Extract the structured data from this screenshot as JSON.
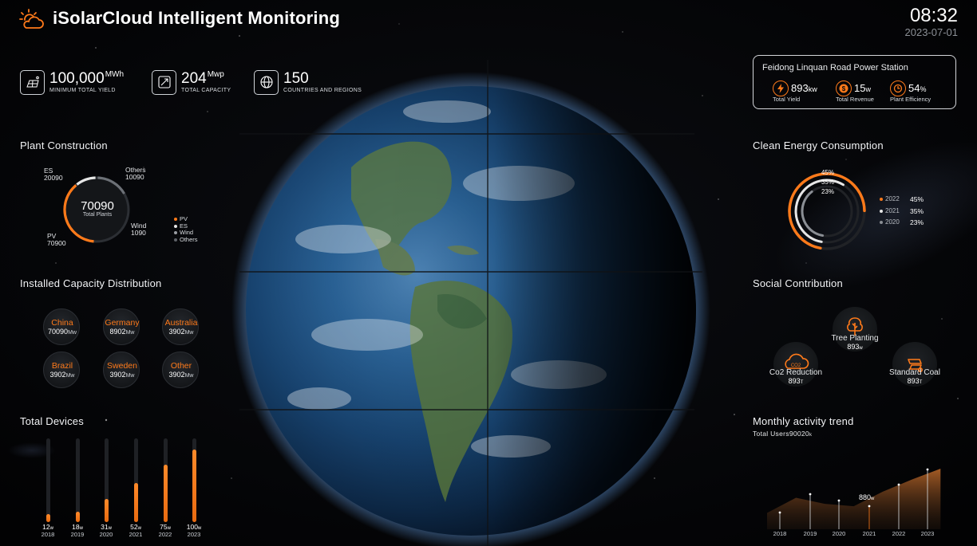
{
  "app": {
    "title": "iSolarCloud Intelligent Monitoring",
    "logo_icon": "sun-cloud-icon"
  },
  "clock": {
    "time": "08:32",
    "date": "2023-07-01"
  },
  "colors": {
    "accent": "#ff7a1a",
    "background": "#050608",
    "text": "#ffffff",
    "muted": "#8c9096"
  },
  "top_stats": [
    {
      "icon": "solar-panel-icon",
      "value": "100,000",
      "unit": "MWh",
      "label": "MINIMUM TOTAL YIELD"
    },
    {
      "icon": "capacity-icon",
      "value": "204",
      "unit": "Mwp",
      "label": "TOTAL CAPACITY"
    },
    {
      "icon": "globe-icon",
      "value": "150",
      "unit": "",
      "label": "COUNTRIES AND REGIONS"
    }
  ],
  "station": {
    "name": "Feidong Linquan Road Power Station",
    "items": [
      {
        "icon": "lightning-icon",
        "value": "893",
        "unit": "kw",
        "label": "Total Yield"
      },
      {
        "icon": "dollar-icon",
        "value": "15",
        "unit": "w",
        "label": "Total Revenue"
      },
      {
        "icon": "clock-icon",
        "value": "54",
        "unit": "%",
        "label": "Plant Efficiency"
      }
    ]
  },
  "plant_construction": {
    "title": "Plant Construction",
    "total": "70090",
    "total_label": "Total Plants",
    "segments": [
      {
        "name": "ES",
        "value": "20090"
      },
      {
        "name": "Others",
        "value": "10090"
      },
      {
        "name": "Wind",
        "value": "1090"
      },
      {
        "name": "PV",
        "value": "70900"
      }
    ],
    "legend": [
      {
        "name": "PV",
        "color": "#ff7a1a"
      },
      {
        "name": "ES",
        "color": "#e6e6e6"
      },
      {
        "name": "Wind",
        "color": "#9a9ea4"
      },
      {
        "name": "Others",
        "color": "#5e6268"
      }
    ]
  },
  "installed_capacity": {
    "title": "Installed Capacity Distribution",
    "items": [
      {
        "name": "China",
        "value": "70090",
        "unit": "Mw"
      },
      {
        "name": "Germany",
        "value": "8902",
        "unit": "Mw"
      },
      {
        "name": "Australia",
        "value": "3902",
        "unit": "Mw"
      },
      {
        "name": "Brazil",
        "value": "3902",
        "unit": "Mw"
      },
      {
        "name": "Sweden",
        "value": "3902",
        "unit": "Mw"
      },
      {
        "name": "Other",
        "value": "3902",
        "unit": "Mw"
      }
    ]
  },
  "clean_energy": {
    "title": "Clean Energy Consumption",
    "rings": [
      {
        "label": "45%",
        "year": "2022",
        "value": "45%",
        "fraction": 0.45,
        "color": "#ff7a1a"
      },
      {
        "label": "35%",
        "year": "2021",
        "value": "35%",
        "fraction": 0.35,
        "color": "#e6e6e6"
      },
      {
        "label": "23%",
        "year": "2020",
        "value": "23%",
        "fraction": 0.23,
        "color": "#8a8e94"
      }
    ]
  },
  "social": {
    "title": "Social Contribution",
    "items": [
      {
        "icon": "tree-icon",
        "label": "Tree Planting",
        "value": "893",
        "unit": "w"
      },
      {
        "icon": "co2-cloud-icon",
        "label": "Co2 Reduction",
        "value": "893",
        "unit": "T"
      },
      {
        "icon": "coal-icon",
        "label": "Standard Coal",
        "value": "893",
        "unit": "T"
      }
    ]
  },
  "devices": {
    "title": "Total Devices",
    "bars": [
      {
        "value": "12",
        "unit": "w",
        "year": "2018",
        "level": 0.1
      },
      {
        "value": "18",
        "unit": "w",
        "year": "2019",
        "level": 0.12
      },
      {
        "value": "31",
        "unit": "w",
        "year": "2020",
        "level": 0.28
      },
      {
        "value": "52",
        "unit": "w",
        "year": "2021",
        "level": 0.47
      },
      {
        "value": "75",
        "unit": "w",
        "year": "2022",
        "level": 0.69
      },
      {
        "value": "100",
        "unit": "w",
        "year": "2023",
        "level": 0.87
      }
    ]
  },
  "monthly_trend": {
    "title": "Monthly activity trend",
    "users_label": "Total Users",
    "users_value": "90020",
    "users_unit": "k",
    "callout_value": "880",
    "callout_unit": "w",
    "years": [
      "2018",
      "2019",
      "2020",
      "2021",
      "2022",
      "2023"
    ],
    "levels": [
      0.27,
      0.52,
      0.42,
      0.38,
      0.62,
      0.82,
      1.0
    ]
  }
}
